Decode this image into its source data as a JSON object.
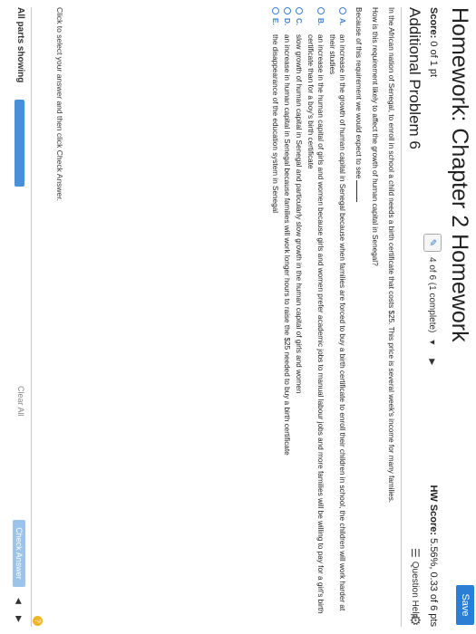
{
  "header": {
    "title": "Homework: Chapter 2 Homework",
    "save_label": "Save"
  },
  "meta": {
    "score_label": "Score:",
    "score_value": "0 of 1 pt",
    "progress": "4 of 6 (1 complete)",
    "hw_score_label": "HW Score:",
    "hw_score_value": "5.56%, 0.33 of 6 pts"
  },
  "problem": {
    "title": "Additional Problem 6",
    "help_label": "Question Help"
  },
  "question": {
    "paragraph1": "In the African nation of Senegal, to enroll in school a child needs a birth certificate that costs $25. This price is several week's income for many families.",
    "paragraph2": "How is this requirement likely to affect the growth of human capital in Senegal?",
    "prompt": "Because of this requirement we would expect to see",
    "options": [
      {
        "letter": "A.",
        "text": "an increase in the growth of human capital in Senegal because when families are forced to buy a birth certificate to enroll their children in school, the children will work harder at their studies"
      },
      {
        "letter": "B.",
        "text": "an increase in the human capital of girls and women because girls and women prefer academic jobs to manual labour jobs and more families will be willing to pay for a girl's birth certificate than for a boy's birth certificate"
      },
      {
        "letter": "C.",
        "text": "slow growth of human capital in Senegal and particularly slow growth in the human capital of girls and women"
      },
      {
        "letter": "D.",
        "text": "an increase in human capital in Senegal because families will work longer hours to raise the $25 needed to buy a birth certificate"
      },
      {
        "letter": "E.",
        "text": "the disappearance of the education system in Senegal"
      }
    ]
  },
  "footer": {
    "instruction": "Click to select your answer and then click Check Answer.",
    "parts_label": "All parts showing",
    "clear_all": "Clear All",
    "check_answer": "Check Answer"
  },
  "colors": {
    "accent": "#2a7fd4",
    "check_answer_bg": "#9cc3ea",
    "parts_bar": "#4a90d9",
    "help_circle": "#f0b429"
  }
}
